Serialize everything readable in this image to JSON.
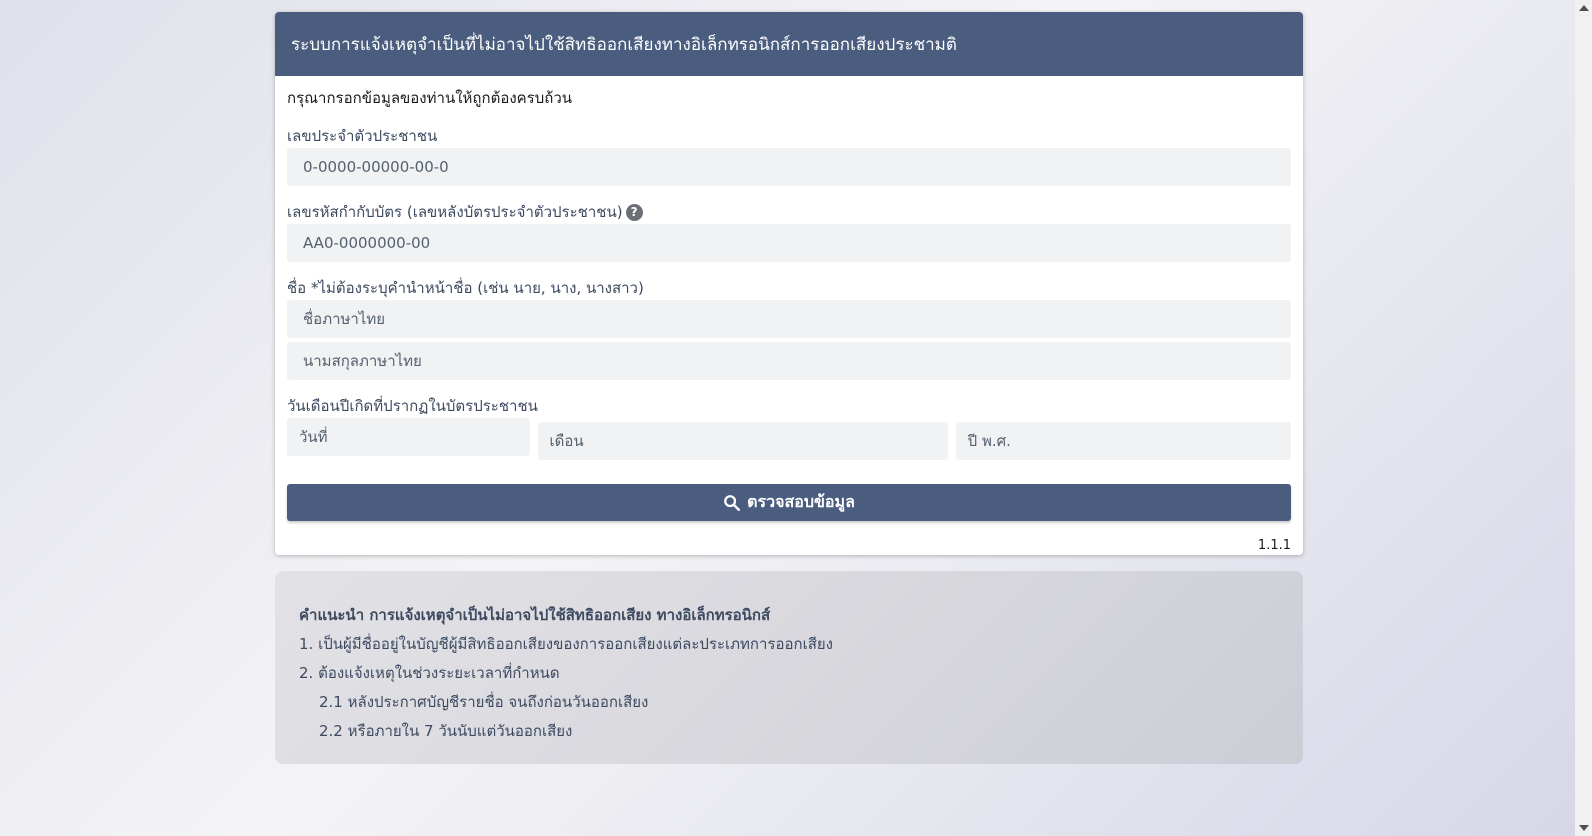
{
  "header": {
    "title": "ระบบการแจ้งเหตุจำเป็นที่ไม่อาจไปใช้สิทธิออกเสียงทางอิเล็กทรอนิกส์การออกเสียงประชามติ"
  },
  "form": {
    "subtitle": "กรุณากรอกข้อมูลของท่านให้ถูกต้องครบถ้วน",
    "citizen_id": {
      "label": "เลขประจำตัวประชาชน",
      "placeholder": "0-0000-00000-00-0"
    },
    "laser_code": {
      "label": "เลขรหัสกำกับบัตร (เลขหลังบัตรประจำตัวประชาชน)",
      "placeholder": "AA0-0000000-00",
      "help": "?"
    },
    "name": {
      "label": "ชื่อ *ไม่ต้องระบุคำนำหน้าชื่อ (เช่น นาย, นาง, นางสาว)",
      "first_placeholder": "ชื่อภาษาไทย",
      "last_placeholder": "นามสกุลภาษาไทย"
    },
    "dob": {
      "label": "วันเดือนปีเกิดที่ปรากฏในบัตรประชาชน",
      "day": "วันที่",
      "month": "เดือน",
      "year": "ปี พ.ศ."
    },
    "submit_label": "ตรวจสอบข้อมูล",
    "version": "1.1.1"
  },
  "info": {
    "title": "คำแนะนำ การแจ้งเหตุจำเป็นไม่อาจไปใช้สิทธิออกเสียง ทางอิเล็กทรอนิกส์",
    "items": [
      "1. เป็นผู้มีชื่ออยู่ในบัญชีผู้มีสิทธิออกเสียงของการออกเสียงแต่ละประเภทการออกเสียง",
      "2. ต้องแจ้งเหตุในช่วงระยะเวลาที่กำหนด",
      "2.1 หลังประกาศบัญชีรายชื่อ จนถึงก่อนวันออกเสียง",
      "2.2 หรือภายใน 7 วันนับแต่วันออกเสียง"
    ]
  },
  "colors": {
    "primary": "#4a5d7e",
    "input_bg": "#f1f2f4"
  }
}
